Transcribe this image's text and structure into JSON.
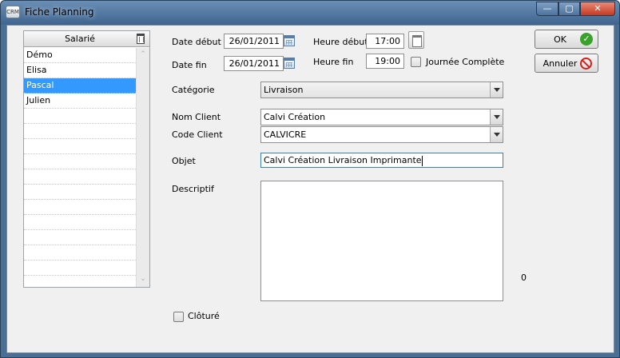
{
  "window": {
    "title": "Fiche Planning",
    "app_icon": "app-logo",
    "controls": {
      "minimize": "—",
      "maximize": "▢",
      "close": "✕"
    }
  },
  "employees": {
    "header": "Salarié",
    "items": [
      "Démo",
      "Elisa",
      "Pascal",
      "Julien"
    ],
    "selected": "Pascal"
  },
  "form": {
    "date_start_label": "Date début",
    "date_start_value": "26/01/2011",
    "date_end_label": "Date fin",
    "date_end_value": "26/01/2011",
    "hour_start_label": "Heure début",
    "hour_start_value": "17:00",
    "hour_end_label": "Heure fin",
    "hour_end_value": "19:00",
    "full_day_label": "Journée Complète",
    "category_label": "Catégorie",
    "category_value": "Livraison",
    "client_name_label": "Nom Client",
    "client_name_value": "Calvi Création",
    "client_code_label": "Code Client",
    "client_code_value": "CALVICRE",
    "object_label": "Objet",
    "object_value": "Calvi Création Livraison Imprimante",
    "description_label": "Descriptif",
    "description_value": "",
    "description_count": "0",
    "closed_label": "Clôturé"
  },
  "actions": {
    "ok_label": "OK",
    "cancel_label": "Annuler"
  },
  "colors": {
    "selection": "#3399ff",
    "ok": "#3aa22c",
    "cancel": "#d0201a"
  }
}
